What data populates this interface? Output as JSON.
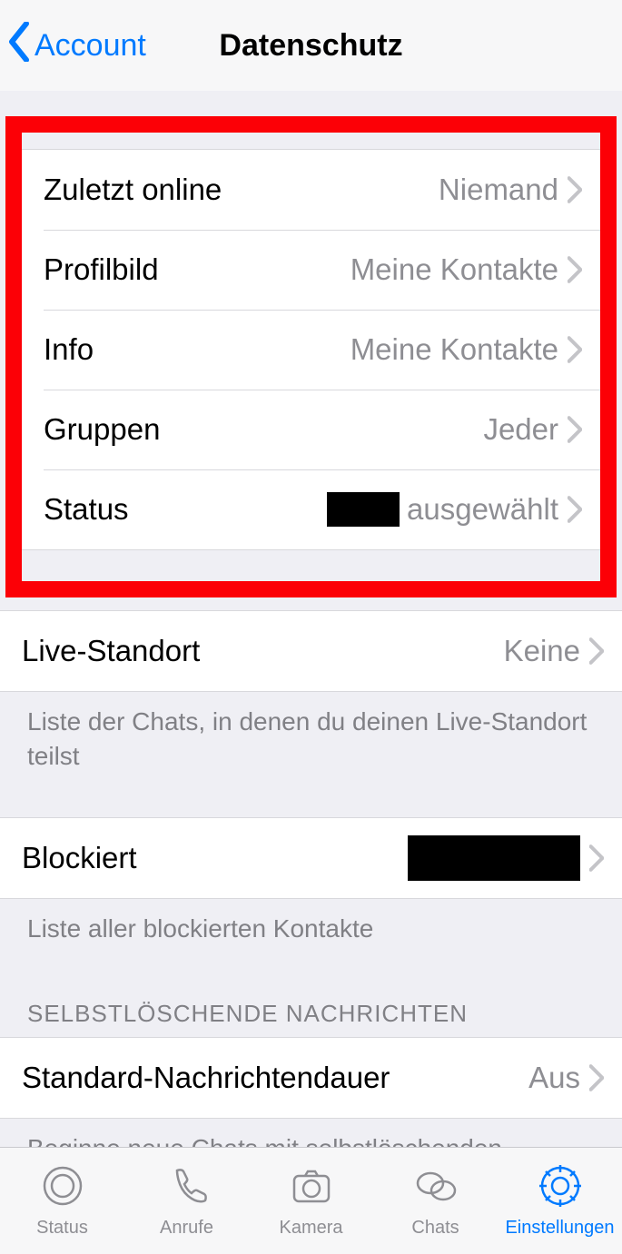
{
  "nav": {
    "back": "Account",
    "title": "Datenschutz"
  },
  "privacyGroup": [
    {
      "label": "Zuletzt online",
      "value": "Niemand"
    },
    {
      "label": "Profilbild",
      "value": "Meine Kontakte"
    },
    {
      "label": "Info",
      "value": "Meine Kontakte"
    },
    {
      "label": "Gruppen",
      "value": "Jeder"
    },
    {
      "label": "Status",
      "value": "ausgewählt",
      "redactedPrefix": true
    }
  ],
  "liveLocation": {
    "label": "Live-Standort",
    "value": "Keine",
    "note": "Liste der Chats, in denen du deinen Live-Standort teilst"
  },
  "blocked": {
    "label": "Blockiert",
    "redacted": true,
    "note": "Liste aller blockierten Kontakte"
  },
  "disappearing": {
    "header": "SELBSTLÖSCHENDE NACHRICHTEN",
    "row": {
      "label": "Standard-Nachrichtendauer",
      "value": "Aus"
    },
    "note": "Beginne neue Chats mit selbstlöschenden"
  },
  "tabs": {
    "status": "Status",
    "calls": "Anrufe",
    "camera": "Kamera",
    "chats": "Chats",
    "settings": "Einstellungen"
  }
}
